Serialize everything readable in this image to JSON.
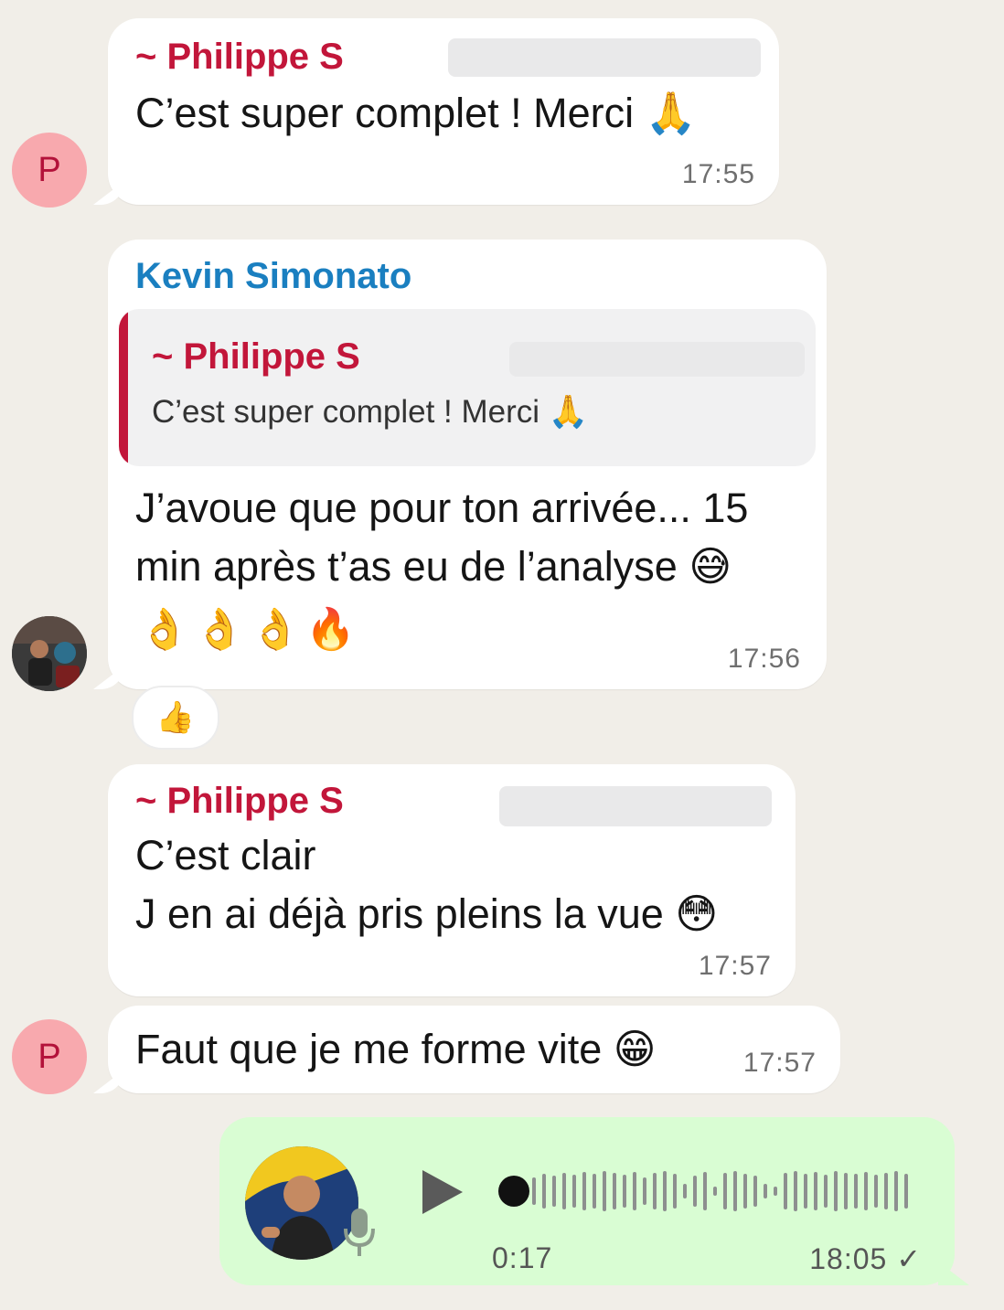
{
  "messages": [
    {
      "sender": "Philippe S",
      "sender_prefix": "~",
      "text": "C’est super complet ! Merci",
      "emoji": "🙏",
      "time": "17:55",
      "avatar_initial": "P"
    },
    {
      "sender": "Kevin Simonato",
      "quote": {
        "sender_prefix": "~",
        "sender": "Philippe S",
        "text": "C’est super complet ! Merci",
        "emoji": "🙏"
      },
      "text_line1": "J’avoue que pour ton arrivée... 15",
      "text_line2": "min après t’as eu de l’analyse",
      "emoji_inline": "😅",
      "emoji_line": "👌👌👌🔥",
      "time": "17:56",
      "reaction": "👍"
    },
    {
      "sender_prefix": "~",
      "sender": "Philippe S",
      "text_line1": "C’est clair",
      "text_line2": "J en ai déjà pris pleins la vue",
      "emoji": "😳",
      "time": "17:57"
    },
    {
      "text": "Faut que je me forme vite",
      "emoji": "😁",
      "time": "17:57",
      "avatar_initial": "P"
    }
  ],
  "voice_note": {
    "duration": "0:17",
    "time": "18:05",
    "status": "✓",
    "play_icon": "play-icon",
    "mic_icon": "microphone-icon"
  },
  "colors": {
    "background": "#f1eee8",
    "incoming_bubble": "#ffffff",
    "outgoing_bubble": "#d9fdd3",
    "sender_red": "#c2163a",
    "sender_blue": "#1a7fc0",
    "avatar_pink": "#f8a9ae"
  }
}
